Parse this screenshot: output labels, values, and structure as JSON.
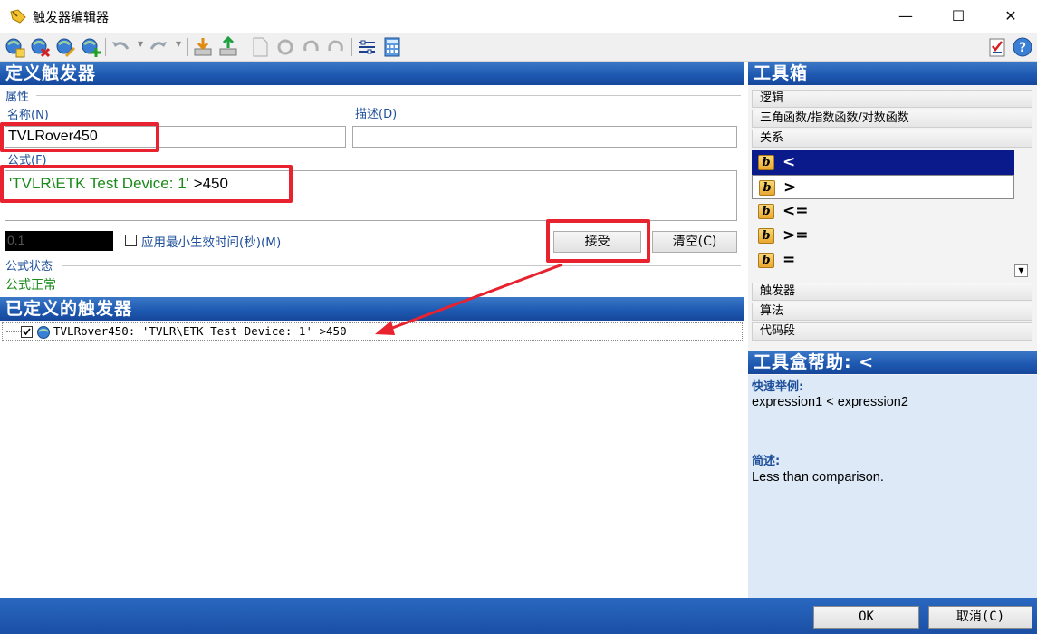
{
  "window": {
    "title": "触发器编辑器",
    "minimize": "—",
    "maximize": "☐",
    "close": "✕"
  },
  "define_section": {
    "header": "定义触发器",
    "properties_group": "属性",
    "name_label": "名称(N)",
    "name_value": "TVLRover450",
    "desc_label": "描述(D)",
    "desc_value": "",
    "formula_label": "公式(F)",
    "formula_quoted": "'TVLR\\ETK Test Device: 1'",
    "formula_rest": " >450",
    "min_time_value": "0.1",
    "min_time_label": "应用最小生效时间(秒)(M)",
    "accept_button": "接受",
    "clear_button": "清空(C)",
    "status_group": "公式状态",
    "status_value": "公式正常"
  },
  "defined_section": {
    "header": "已定义的触发器",
    "items": [
      {
        "text": "TVLRover450: 'TVLR\\ETK Test Device: 1' >450"
      }
    ]
  },
  "toolbox": {
    "header": "工具箱",
    "categories_top": [
      "逻辑",
      "三角函数/指数函数/对数函数",
      "关系"
    ],
    "items": [
      {
        "symbol": "<",
        "icon": "b"
      },
      {
        "symbol": ">",
        "icon": "b"
      },
      {
        "symbol": "<=",
        "icon": "b"
      },
      {
        "symbol": ">=",
        "icon": "b"
      },
      {
        "symbol": "=",
        "icon": "b"
      },
      {
        "symbol": "!=",
        "icon": "b"
      }
    ],
    "categories_bottom": [
      "触发器",
      "算法",
      "代码段"
    ]
  },
  "help": {
    "header": "工具盒帮助: <",
    "example_heading": "快速举例:",
    "example_text": "expression1 < expression2",
    "desc_heading": "简述:",
    "desc_text": "Less than comparison."
  },
  "bottom": {
    "ok_button": "OK",
    "cancel_button": "取消(C)"
  },
  "colors": {
    "accent_blue": "#1d58b0",
    "highlight_red": "#e8222e",
    "formula_green": "#1a8a1a",
    "selected_item": "#0a1a8a"
  }
}
